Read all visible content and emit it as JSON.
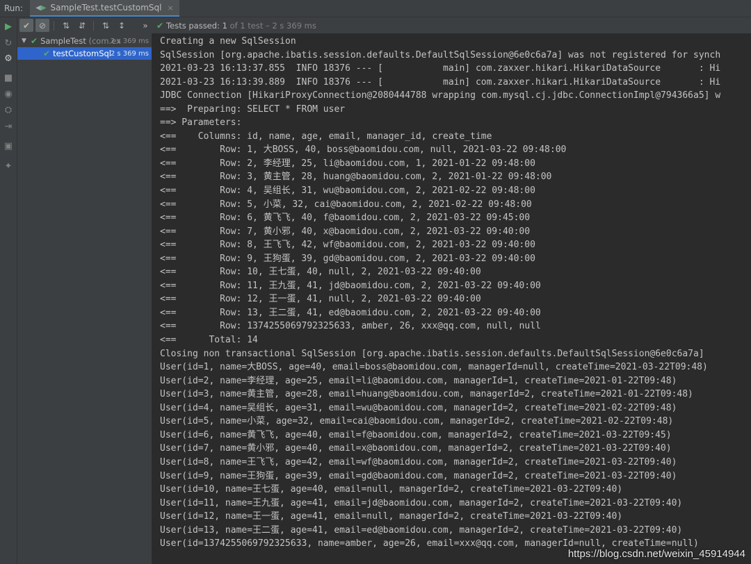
{
  "tabbar": {
    "run_label": "Run:",
    "tab_label": "SampleTest.testCustomSql",
    "close_glyph": "×"
  },
  "toolbar": {
    "status_passed": "Tests passed:",
    "status_count": "1",
    "status_detail": "of 1 test – 2 s 369 ms"
  },
  "tree": {
    "items": [
      {
        "label": "SampleTest",
        "package": "(com.ex",
        "time": "2 s 369 ms"
      },
      {
        "label": "testCustomSql",
        "time": "2 s 369 ms"
      }
    ]
  },
  "console": {
    "lines": [
      "Creating a new SqlSession",
      "SqlSession [org.apache.ibatis.session.defaults.DefaultSqlSession@6e0c6a7a] was not registered for synch",
      "2021-03-23 16:13:37.855  INFO 18376 --- [           main] com.zaxxer.hikari.HikariDataSource       : Hi",
      "2021-03-23 16:13:39.889  INFO 18376 --- [           main] com.zaxxer.hikari.HikariDataSource       : Hi",
      "JDBC Connection [HikariProxyConnection@2080444788 wrapping com.mysql.cj.jdbc.ConnectionImpl@794366a5] w",
      "==>  Preparing: SELECT * FROM user",
      "==> Parameters: ",
      "<==    Columns: id, name, age, email, manager_id, create_time",
      "<==        Row: 1, 大BOSS, 40, boss@baomidou.com, null, 2021-03-22 09:48:00",
      "<==        Row: 2, 李经理, 25, li@baomidou.com, 1, 2021-01-22 09:48:00",
      "<==        Row: 3, 黄主管, 28, huang@baomidou.com, 2, 2021-01-22 09:48:00",
      "<==        Row: 4, 吴组长, 31, wu@baomidou.com, 2, 2021-02-22 09:48:00",
      "<==        Row: 5, 小菜, 32, cai@baomidou.com, 2, 2021-02-22 09:48:00",
      "<==        Row: 6, 黄飞飞, 40, f@baomidou.com, 2, 2021-03-22 09:45:00",
      "<==        Row: 7, 黄小邪, 40, x@baomidou.com, 2, 2021-03-22 09:40:00",
      "<==        Row: 8, 王飞飞, 42, wf@baomidou.com, 2, 2021-03-22 09:40:00",
      "<==        Row: 9, 王狗蛋, 39, gd@baomidou.com, 2, 2021-03-22 09:40:00",
      "<==        Row: 10, 王七蛋, 40, null, 2, 2021-03-22 09:40:00",
      "<==        Row: 11, 王九蛋, 41, jd@baomidou.com, 2, 2021-03-22 09:40:00",
      "<==        Row: 12, 王一蛋, 41, null, 2, 2021-03-22 09:40:00",
      "<==        Row: 13, 王二蛋, 41, ed@baomidou.com, 2, 2021-03-22 09:40:00",
      "<==        Row: 1374255069792325633, amber, 26, xxx@qq.com, null, null",
      "<==      Total: 14",
      "Closing non transactional SqlSession [org.apache.ibatis.session.defaults.DefaultSqlSession@6e0c6a7a]",
      "User(id=1, name=大BOSS, age=40, email=boss@baomidou.com, managerId=null, createTime=2021-03-22T09:48)",
      "User(id=2, name=李经理, age=25, email=li@baomidou.com, managerId=1, createTime=2021-01-22T09:48)",
      "User(id=3, name=黄主管, age=28, email=huang@baomidou.com, managerId=2, createTime=2021-01-22T09:48)",
      "User(id=4, name=吴组长, age=31, email=wu@baomidou.com, managerId=2, createTime=2021-02-22T09:48)",
      "User(id=5, name=小菜, age=32, email=cai@baomidou.com, managerId=2, createTime=2021-02-22T09:48)",
      "User(id=6, name=黄飞飞, age=40, email=f@baomidou.com, managerId=2, createTime=2021-03-22T09:45)",
      "User(id=7, name=黄小邪, age=40, email=x@baomidou.com, managerId=2, createTime=2021-03-22T09:40)",
      "User(id=8, name=王飞飞, age=42, email=wf@baomidou.com, managerId=2, createTime=2021-03-22T09:40)",
      "User(id=9, name=王狗蛋, age=39, email=gd@baomidou.com, managerId=2, createTime=2021-03-22T09:40)",
      "User(id=10, name=王七蛋, age=40, email=null, managerId=2, createTime=2021-03-22T09:40)",
      "User(id=11, name=王九蛋, age=41, email=jd@baomidou.com, managerId=2, createTime=2021-03-22T09:40)",
      "User(id=12, name=王一蛋, age=41, email=null, managerId=2, createTime=2021-03-22T09:40)",
      "User(id=13, name=王二蛋, age=41, email=ed@baomidou.com, managerId=2, createTime=2021-03-22T09:40)",
      "User(id=1374255069792325633, name=amber, age=26, email=xxx@qq.com, managerId=null, createTime=null)"
    ]
  },
  "watermark": "https://blog.csdn.net/weixin_45914944",
  "icons": {
    "run": "run-icon",
    "rerun": "rerun-icon",
    "debug": "debug-icon",
    "stop": "stop-icon",
    "camera": "camera-icon",
    "settings": "settings-icon",
    "exit": "exit-icon",
    "layout": "layout-icon",
    "pin": "pin-icon"
  },
  "colors": {
    "pass": "#59a869",
    "selection": "#2f65ca",
    "console_bg": "#2b2b2b",
    "panel_bg": "#3c3f41"
  }
}
